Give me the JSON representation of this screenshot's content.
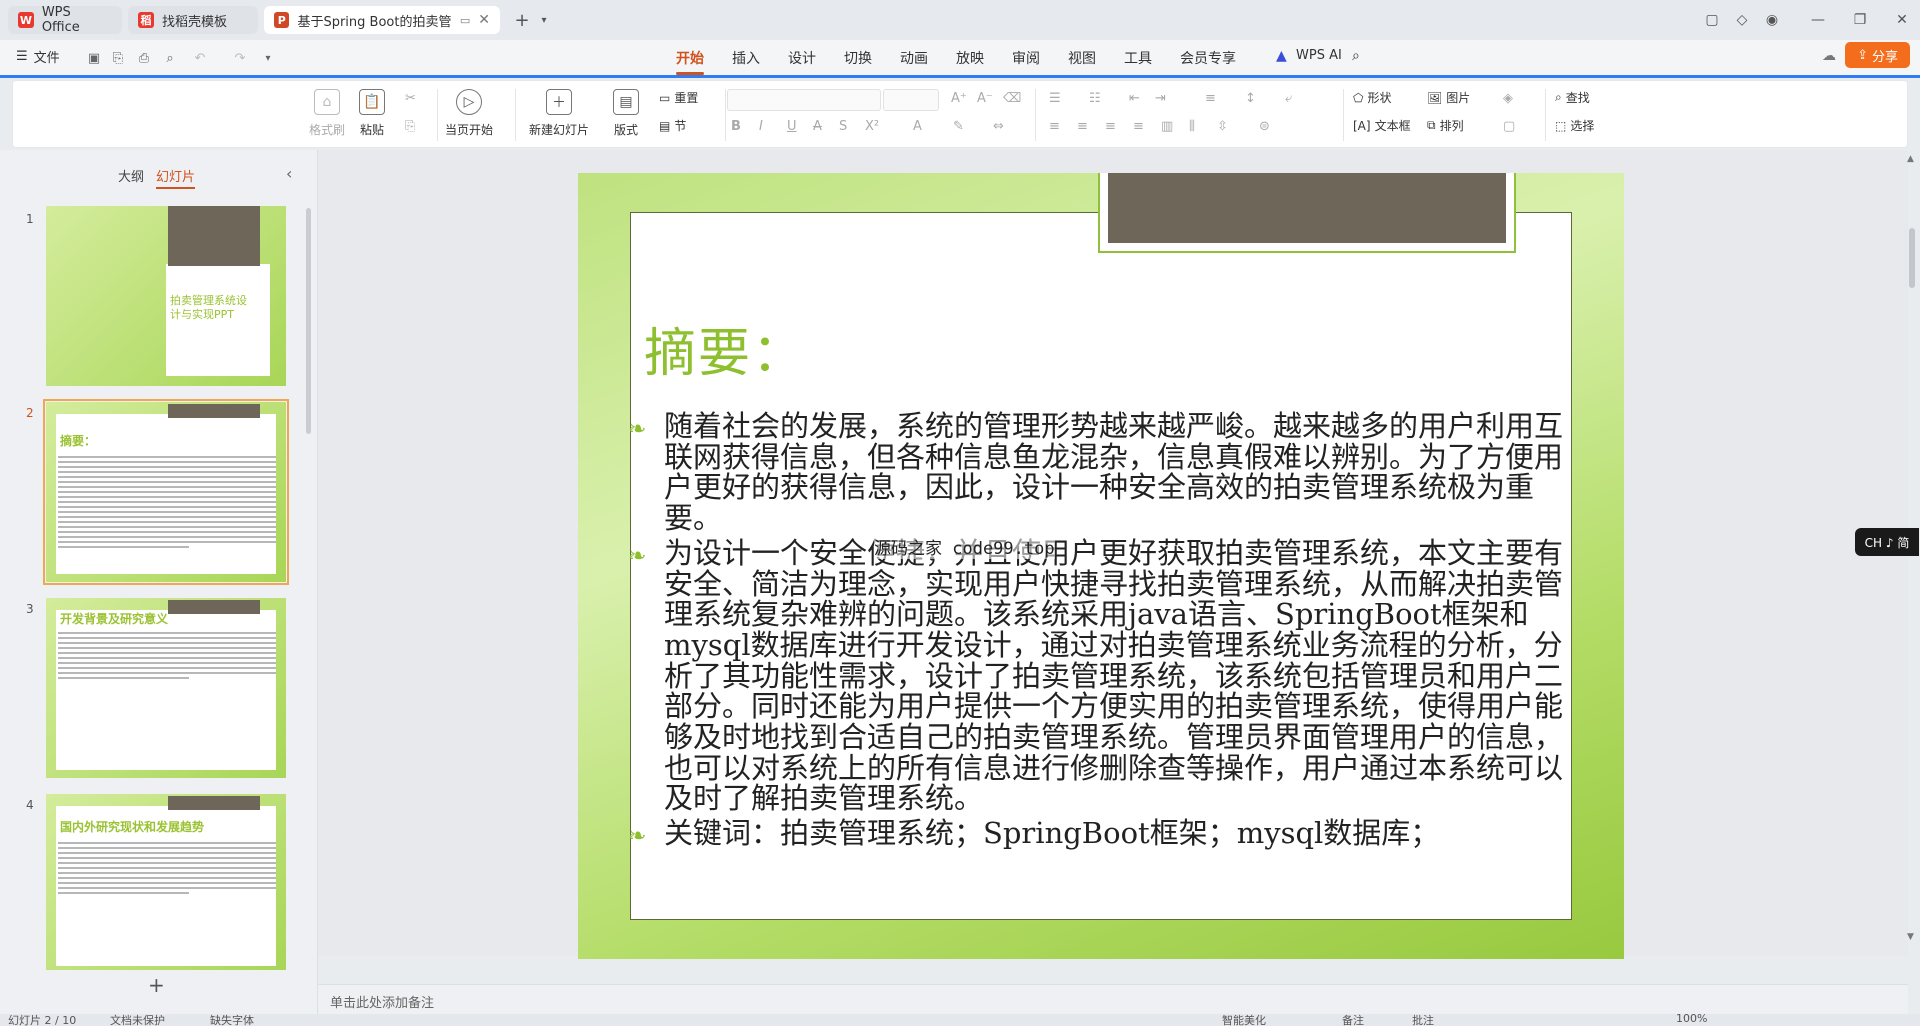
{
  "tabs": [
    {
      "label": "WPS Office",
      "icon": "wps-logo-icon"
    },
    {
      "label": "找稻壳模板",
      "icon": "docer-icon"
    },
    {
      "label": "基于Spring Boot的拍卖管理",
      "icon": "ppt-file-icon"
    }
  ],
  "menu": {
    "file_label": "文件",
    "items": [
      "开始",
      "插入",
      "设计",
      "切换",
      "动画",
      "放映",
      "审阅",
      "视图",
      "工具",
      "会员专享"
    ],
    "active": "开始",
    "wps_ai_label": "WPS AI",
    "share_label": "分享"
  },
  "ribbon": {
    "format_painter": "格式刷",
    "paste": "粘贴",
    "play_current": "当页开始",
    "new_slide": "新建幻灯片",
    "layout": "版式",
    "section": "节",
    "reset": "重置",
    "shape": "形状",
    "picture": "图片",
    "textbox": "文本框",
    "arrange": "排列",
    "find": "查找",
    "select": "选择"
  },
  "left_panel": {
    "tab_outline": "大纲",
    "tab_slides": "幻灯片",
    "active_tab": "幻灯片",
    "thumbnails": [
      {
        "num": "1",
        "title": "拍卖管理系统设计与实现PPT"
      },
      {
        "num": "2",
        "title": "摘要："
      },
      {
        "num": "3",
        "title": "开发背景及研究意义"
      },
      {
        "num": "4",
        "title": "国内外研究现状和发展趋势"
      }
    ],
    "selected": "2"
  },
  "slide": {
    "title": "摘要：",
    "paragraphs": [
      "  随着社会的发展，系统的管理形势越来越严峻。越来越多的用户利用互联网获得信息，但各种信息鱼龙混杂，信息真假难以辨别。为了方便用户更好的获得信息，因此，设计一种安全高效的拍卖管理系统极为重要。",
      "为设计一个安全便捷，并且使用户更好获取拍卖管理系统，本文主要有安全、简洁为理念，实现用户快捷寻找拍卖管理系统，从而解决拍卖管理系统复杂难辨的问题。该系统采用java语言、SpringBoot框架和mysql数据库进行开发设计，通过对拍卖管理系统业务流程的分析，分析了其功能性需求，设计了拍卖管理系统，该系统包括管理员和用户二部分。同时还能为用户提供一个方便实用的拍卖管理系统，使得用户能够及时地找到合适自己的拍卖管理系统。管理员界面管理用户的信息，也可以对系统上的所有信息进行修删除查等操作，用户通过本系统可以及时了解拍卖管理系统。",
      "关键词：拍卖管理系统；SpringBoot框架；mysql数据库；"
    ],
    "watermark": "源码之家 code99.top"
  },
  "notes_placeholder": "单击此处添加备注",
  "ime_label": "CH ♪ 简",
  "statusbar": {
    "slide_info": "幻灯片 2 / 10",
    "spellcheck": "文档未保护",
    "font_missing": "缺失字体",
    "smart_beautify": "智能美化",
    "notes": "备注",
    "comments": "批注",
    "zoom": "100%"
  },
  "colors": {
    "accent": "#d0521c",
    "slide_green": "#8dbf2e",
    "banner_brown": "#6f665a",
    "share_orange": "#f46d1c"
  }
}
